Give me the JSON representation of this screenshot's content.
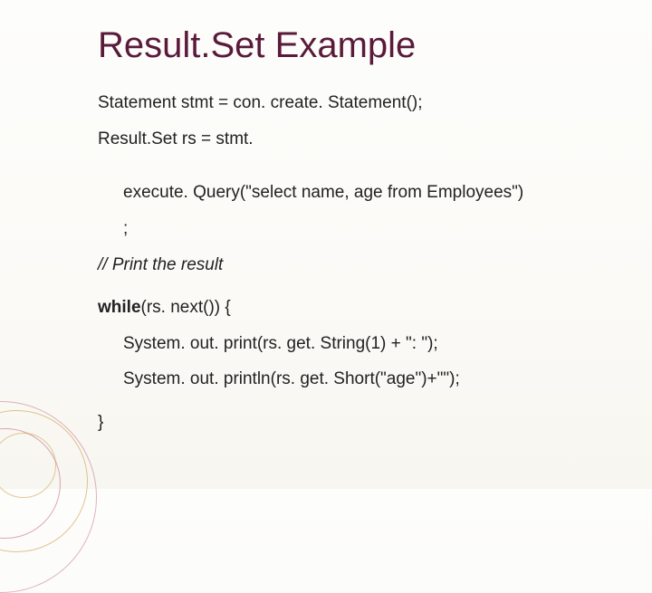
{
  "title": "Result.Set Example",
  "lines": {
    "l1": "Statement stmt = con. create. Statement();",
    "l2": "Result.Set rs = stmt.",
    "l3": "execute. Query(\"select name, age from Employees\")",
    "l3b": ";",
    "l4": "// Print the result",
    "l5a": "while",
    "l5b": "(rs. next()) {",
    "l6": "System. out. print(rs. get. String(1) + \": \");",
    "l7": "System. out. println(rs. get. Short(\"age\")+\"\");",
    "l8": "}"
  }
}
